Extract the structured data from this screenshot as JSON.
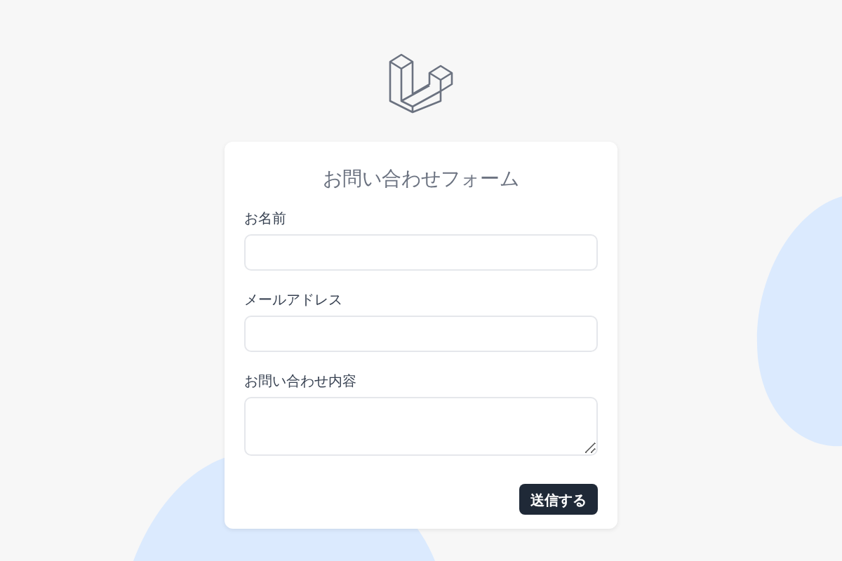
{
  "form": {
    "title": "お問い合わせフォーム",
    "fields": [
      {
        "kind": "input",
        "label": "お名前"
      },
      {
        "kind": "input",
        "label": "メールアドレス"
      },
      {
        "kind": "textarea",
        "label": "お問い合わせ内容"
      }
    ],
    "submit": "送信する"
  }
}
